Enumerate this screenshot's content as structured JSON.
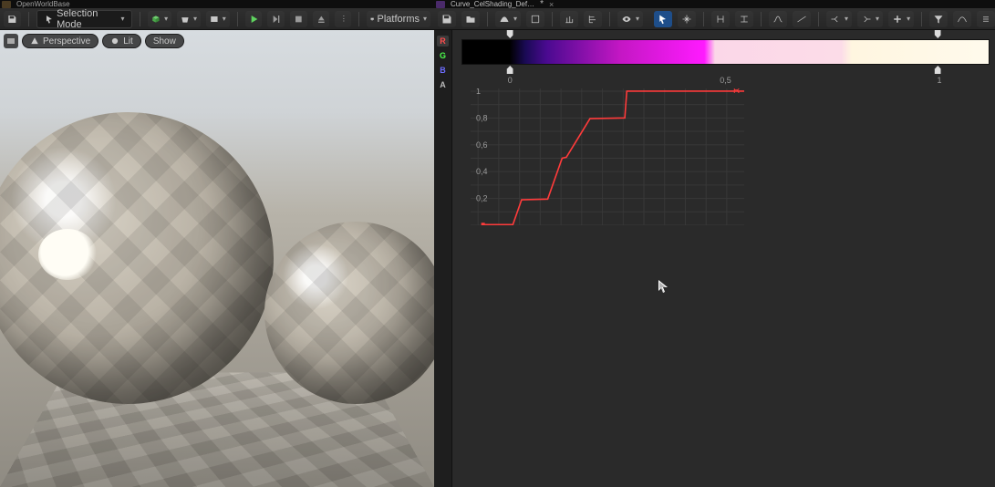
{
  "left": {
    "tab_label": "OpenWorldBase",
    "toolbar": {
      "selection_mode": "Selection Mode",
      "platforms": "Platforms"
    },
    "viewport": {
      "menu_items": [
        "Perspective",
        "Lit",
        "Show"
      ]
    }
  },
  "right": {
    "tab_label": "Curve_CelShading_Def…",
    "channels": [
      "R",
      "G",
      "B",
      "A"
    ],
    "selected_channel": "R",
    "gradient": {
      "top_ticks": [
        0.092,
        0.902
      ],
      "bottom_ticks": [
        0.092,
        0.902
      ],
      "stops": [
        {
          "pos": 0.0,
          "color": "#000000"
        },
        {
          "pos": 0.09,
          "color": "#000000"
        },
        {
          "pos": 0.12,
          "color": "#1a0a55"
        },
        {
          "pos": 0.16,
          "color": "#4a0a90"
        },
        {
          "pos": 0.3,
          "color": "#c417c4"
        },
        {
          "pos": 0.46,
          "color": "#ff1aff"
        },
        {
          "pos": 0.48,
          "color": "#fbd7e8"
        },
        {
          "pos": 0.72,
          "color": "#fcdce8"
        },
        {
          "pos": 0.74,
          "color": "#fff6e0"
        },
        {
          "pos": 1.0,
          "color": "#fffaec"
        }
      ]
    },
    "x_axis_labels": [
      {
        "pos": 0.092,
        "text": "0"
      },
      {
        "pos": 0.5,
        "text": "0,5"
      },
      {
        "pos": 0.905,
        "text": "1"
      }
    ],
    "y_axis_labels": [
      {
        "v": 1.0,
        "text": "1"
      },
      {
        "v": 0.8,
        "text": "0,8"
      },
      {
        "v": 0.6,
        "text": "0,6"
      },
      {
        "v": 0.4,
        "text": "0,4"
      },
      {
        "v": 0.2,
        "text": "0,2"
      }
    ]
  },
  "chart_data": {
    "type": "line",
    "title": "",
    "xlabel": "",
    "ylabel": "",
    "xlim": [
      -0.05,
      1.05
    ],
    "ylim": [
      0.0,
      1.02
    ],
    "series": [
      {
        "name": "R",
        "color": "#ff3b3b",
        "points": [
          {
            "x": 0.0,
            "y": 0.005
          },
          {
            "x": 0.12,
            "y": 0.005
          },
          {
            "x": 0.155,
            "y": 0.19
          },
          {
            "x": 0.26,
            "y": 0.195
          },
          {
            "x": 0.318,
            "y": 0.5
          },
          {
            "x": 0.335,
            "y": 0.507
          },
          {
            "x": 0.43,
            "y": 0.795
          },
          {
            "x": 0.57,
            "y": 0.8
          },
          {
            "x": 0.578,
            "y": 1.0
          },
          {
            "x": 1.0,
            "y": 1.0
          }
        ]
      }
    ]
  },
  "cursor": {
    "xpx": 722,
    "ypx": 307
  }
}
